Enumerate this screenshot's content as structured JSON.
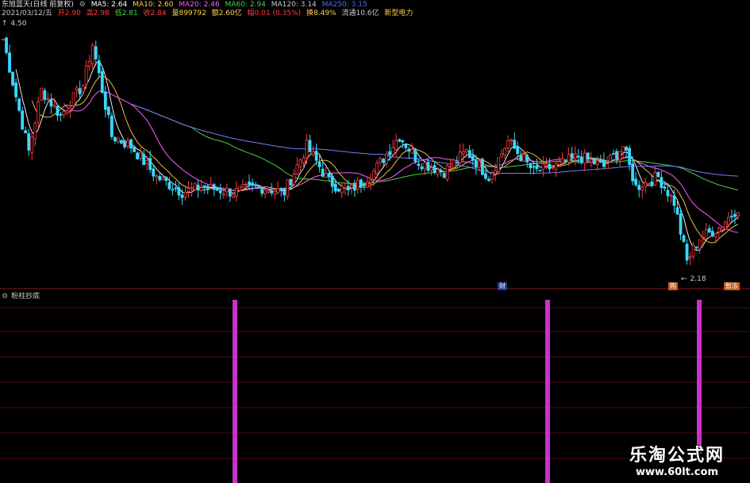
{
  "header": {
    "stock_name": "东旭蓝天(日线 前复权)",
    "ma5": "MA5: 2.64",
    "ma10": "MA10: 2.60",
    "ma20": "MA20: 2.46",
    "ma60": "MA60: 2.94",
    "ma120": "MA120: 3.14",
    "ma250": "MA250: 3.15",
    "date": "2021/03/12/五",
    "open": "开2.90",
    "high": "高2.98",
    "low": "低2.81",
    "close": "收2.84",
    "volume": "量899792",
    "amount": "额2.60亿",
    "change": "幅0.01 (0.35%)",
    "turnover": "换8.49%",
    "float_cap": "流通10.6亿",
    "sector": "新型电力"
  },
  "price_labels": {
    "high_mark": "4.50",
    "low_mark": "2.18",
    "marker_cai": "财",
    "marker_gou": "购",
    "marker_shen": "暂冻"
  },
  "lower_panel": {
    "title": "粉柱抄底"
  },
  "watermark": {
    "line1": "乐淘公式网",
    "line2": "www.60lt.com"
  },
  "colors": {
    "up": "#ff3c3c",
    "down": "#38d8ff",
    "ma5": "#ffffff",
    "ma10": "#ffd24a",
    "ma20": "#ff5cff",
    "ma60": "#46d246",
    "ma120": "#7a7aff",
    "ma250": "#4a6cff",
    "bar": "#c832c8",
    "grid": "#5a0a0a"
  },
  "chart_data": {
    "type": "candlestick",
    "title": "东旭蓝天(日线 前复权)",
    "ylim": [
      2.1,
      4.55
    ],
    "anchors": [
      [
        0,
        4.4
      ],
      [
        5,
        3.7
      ],
      [
        8,
        3.3
      ],
      [
        12,
        3.9
      ],
      [
        18,
        3.65
      ],
      [
        25,
        3.95
      ],
      [
        28,
        4.35
      ],
      [
        34,
        3.45
      ],
      [
        40,
        3.35
      ],
      [
        48,
        3.05
      ],
      [
        56,
        2.9
      ],
      [
        62,
        2.95
      ],
      [
        72,
        2.9
      ],
      [
        80,
        2.95
      ],
      [
        88,
        2.9
      ],
      [
        95,
        3.35
      ],
      [
        102,
        3.0
      ],
      [
        108,
        2.9
      ],
      [
        116,
        3.1
      ],
      [
        124,
        3.45
      ],
      [
        130,
        3.2
      ],
      [
        138,
        3.1
      ],
      [
        145,
        3.3
      ],
      [
        152,
        3.05
      ],
      [
        158,
        3.4
      ],
      [
        166,
        3.1
      ],
      [
        173,
        3.15
      ],
      [
        180,
        3.25
      ],
      [
        188,
        3.15
      ],
      [
        194,
        3.35
      ],
      [
        198,
        2.95
      ],
      [
        205,
        3.05
      ],
      [
        210,
        2.8
      ],
      [
        214,
        2.22
      ],
      [
        218,
        2.45
      ],
      [
        224,
        2.55
      ],
      [
        230,
        2.75
      ]
    ],
    "signal_bars": [
      {
        "x": 296,
        "from": 0,
        "to": 1
      },
      {
        "x": 690,
        "from": 0,
        "to": 1
      },
      {
        "x": 881,
        "from": 0,
        "to": 0.84
      }
    ]
  }
}
